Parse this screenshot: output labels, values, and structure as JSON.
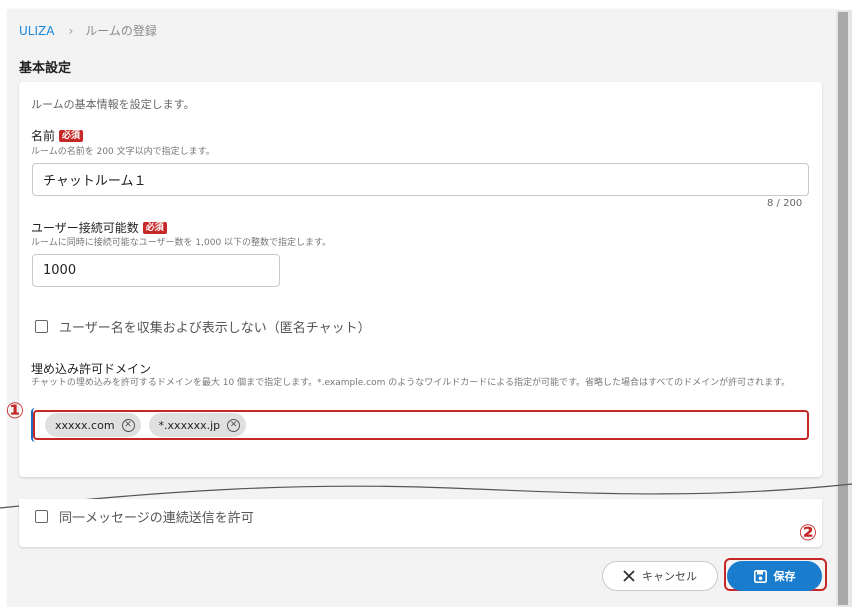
{
  "breadcrumb": {
    "root": "ULIZA",
    "separator": "›",
    "current": "ルームの登録"
  },
  "section_title": "基本設定",
  "card": {
    "description": "ルームの基本情報を設定します。",
    "required_badge": "必須",
    "name_field": {
      "label": "名前",
      "help": "ルームの名前を 200 文字以内で指定します。",
      "value": "チャットルーム１",
      "counter": "8 / 200"
    },
    "max_users_field": {
      "label": "ユーザー接続可能数",
      "help": "ルームに同時に接続可能なユーザー数を 1,000 以下の整数で指定します。",
      "value": "1000"
    },
    "anonymous_checkbox": {
      "label": "ユーザー名を収集および表示しない（匿名チャット）",
      "checked": false
    },
    "embed_domains": {
      "label": "埋め込み許可ドメイン",
      "help": "チャットの埋め込みを許可するドメインを最大 10 個まで指定します。*.example.com のようなワイルドカードによる指定が可能です。省略した場合はすべてのドメインが許可されます。",
      "chips": [
        "xxxxx.com",
        "*.xxxxxx.jp"
      ]
    }
  },
  "consecutive_checkbox": {
    "label": "同一メッセージの連続送信を許可",
    "checked": false
  },
  "buttons": {
    "cancel": "キャンセル",
    "save": "保存"
  },
  "callouts": [
    "①",
    "②"
  ],
  "colors": {
    "accent": "#1a7ccc",
    "link": "#1a86d9",
    "required": "#c62828",
    "highlight": "#c62828"
  }
}
